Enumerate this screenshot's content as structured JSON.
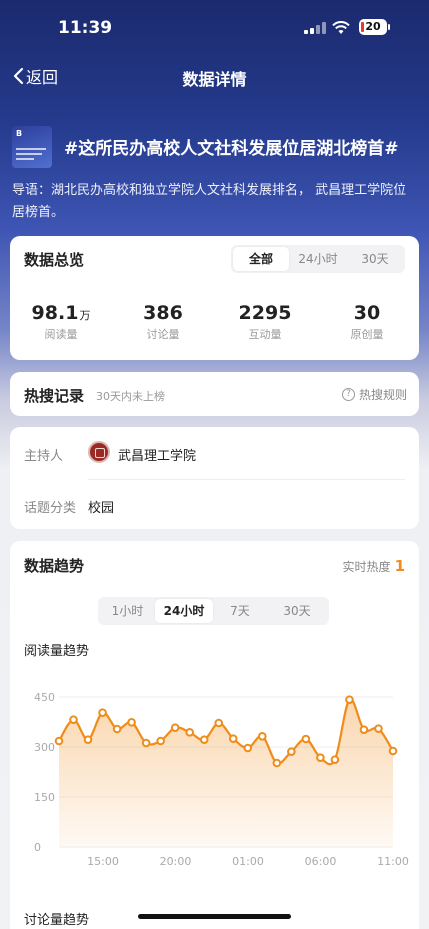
{
  "status": {
    "time": "11:39",
    "battery": "20"
  },
  "nav": {
    "back_label": "返回",
    "title": "数据详情"
  },
  "topic": {
    "title": "#这所民办高校人文社科发展位居湖北榜首#",
    "desc": "导语：湖北民办高校和独立学院人文社科发展排名， 武昌理工学院位居榜首。"
  },
  "overview": {
    "title": "数据总览",
    "tabs": [
      "全部",
      "24小时",
      "30天"
    ],
    "stats": [
      {
        "value": "98.1",
        "unit": "万",
        "label": "阅读量"
      },
      {
        "value": "386",
        "unit": "",
        "label": "讨论量"
      },
      {
        "value": "2295",
        "unit": "",
        "label": "互动量"
      },
      {
        "value": "30",
        "unit": "",
        "label": "原创量"
      }
    ]
  },
  "hot_search": {
    "title": "热搜记录",
    "note": "30天内未上榜",
    "rule_label": "热搜规则",
    "rule_icon": "question-circle-icon"
  },
  "info": {
    "host_label": "主持人",
    "host_name": "武昌理工学院",
    "host_icon": "school-seal-icon",
    "category_label": "话题分类",
    "category_value": "校园"
  },
  "trend": {
    "title": "数据趋势",
    "heat_label": "实时热度",
    "heat_value": "1",
    "tabs": [
      "1小时",
      "24小时",
      "7天",
      "30天"
    ],
    "chart_title": "阅读量趋势",
    "next_chart_title": "讨论量趋势"
  },
  "chart_data": {
    "type": "area",
    "title": "阅读量趋势",
    "x_ticks": [
      "15:00",
      "20:00",
      "01:00",
      "06:00",
      "11:00"
    ],
    "y_ticks": [
      "0",
      "150",
      "300",
      "450"
    ],
    "ylim": [
      0,
      450
    ],
    "color": "#f08c1a",
    "grid": true,
    "values": [
      318,
      382,
      322,
      403,
      354,
      374,
      312,
      318,
      358,
      344,
      322,
      372,
      325,
      297,
      332,
      252,
      286,
      324,
      268,
      262,
      442,
      352,
      355,
      288
    ]
  }
}
